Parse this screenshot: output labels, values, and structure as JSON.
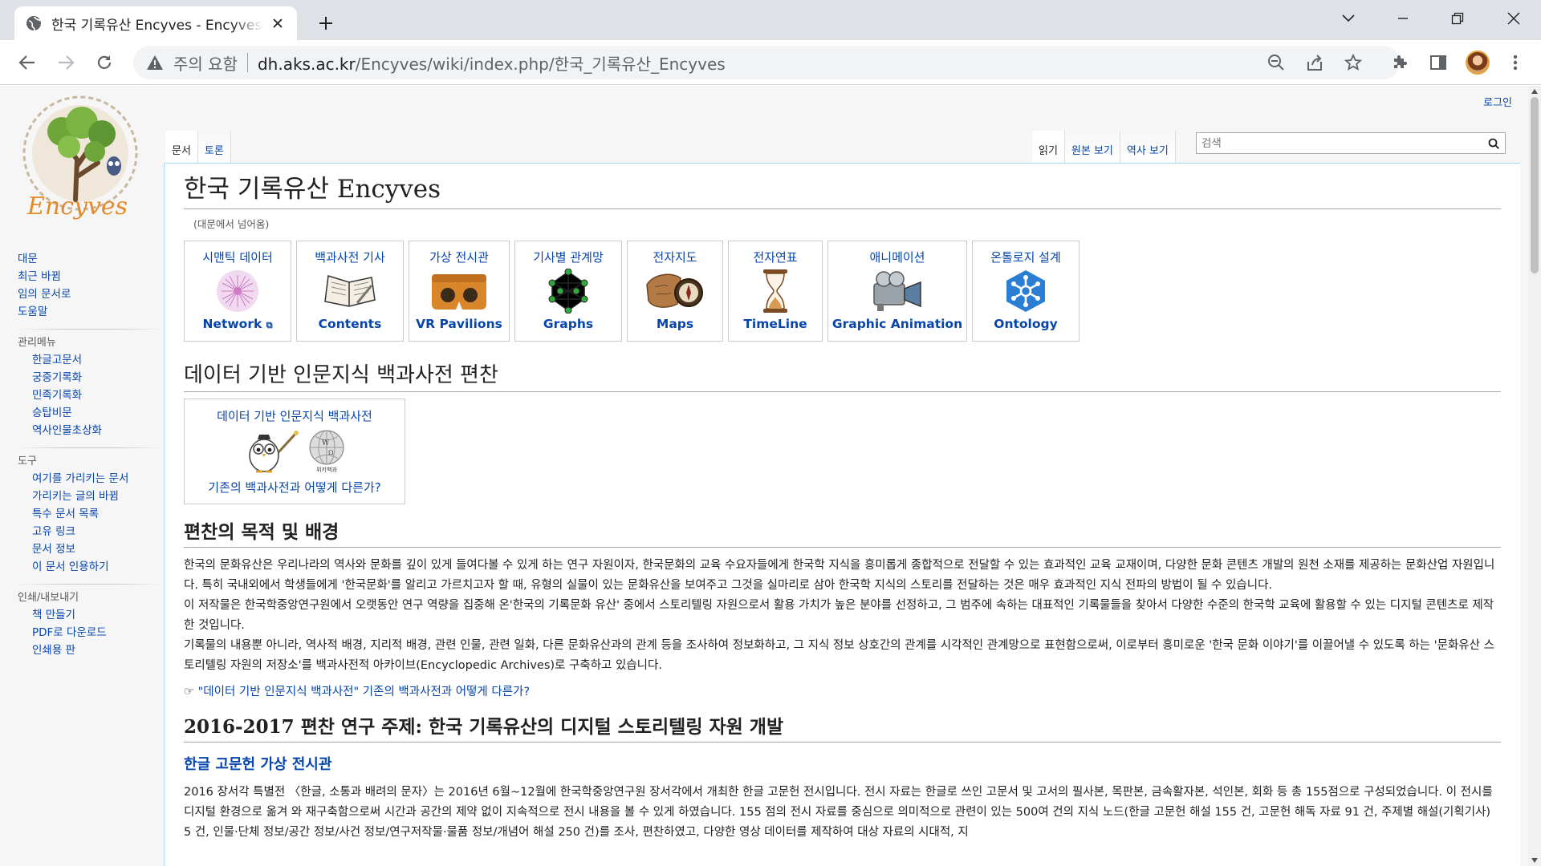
{
  "browser": {
    "tab_title": "한국 기록유산 Encyves - Encyves",
    "address_security": "주의 요함",
    "address_host": "dh.aks.ac.kr",
    "address_path": "/Encyves/wiki/index.php/한국_기록유산_Encyves"
  },
  "header": {
    "login": "로그인",
    "tabs_left": [
      "문서",
      "토론"
    ],
    "tabs_right": [
      "읽기",
      "원본 보기",
      "역사 보기"
    ],
    "search_placeholder": "검색"
  },
  "sidebar": {
    "main": [
      "대문",
      "최근 바뀜",
      "임의 문서로",
      "도움말"
    ],
    "sections": [
      {
        "title": "관리메뉴",
        "items": [
          "한글고문서",
          "궁중기록화",
          "민족기록화",
          "승탑비문",
          "역사인물초상화"
        ]
      },
      {
        "title": "도구",
        "items": [
          "여기를 가리키는 문서",
          "가리키는 글의 바뀜",
          "특수 문서 목록",
          "고유 링크",
          "문서 정보",
          "이 문서 인용하기"
        ]
      },
      {
        "title": "인쇄/내보내기",
        "items": [
          "책 만들기",
          "PDF로 다운로드",
          "인쇄용 판"
        ]
      }
    ]
  },
  "article": {
    "title": "한국 기록유산 Encyves",
    "redirect": "(대문에서 넘어옴)",
    "icons": [
      {
        "top": "시맨틱 데이터",
        "bottom": "Network",
        "icon": "network-icon",
        "width": 132
      },
      {
        "top": "백과사전 기사",
        "bottom": "Contents",
        "icon": "book-icon",
        "width": 134
      },
      {
        "top": "가상 전시관",
        "bottom": "VR Pavilions",
        "icon": "vr-headset-icon",
        "width": 126
      },
      {
        "top": "기사별 관계망",
        "bottom": "Graphs",
        "icon": "graph-icon",
        "width": 134
      },
      {
        "top": "전자지도",
        "bottom": "Maps",
        "icon": "map-compass-icon",
        "width": 118
      },
      {
        "top": "전자연표",
        "bottom": "TimeLine",
        "icon": "hourglass-icon",
        "width": 118
      },
      {
        "top": "애니메이션",
        "bottom": "Graphic Animation",
        "icon": "camera-icon",
        "width": 174
      },
      {
        "top": "온톨로지 설계",
        "bottom": "Ontology",
        "icon": "ontology-icon",
        "width": 134
      }
    ],
    "section1": "데이터 기반 인문지식 백과사전 편찬",
    "compare_line1": "데이터 기반 인문지식 백과사전",
    "compare_line2": "기존의 백과사전과 어떻게 다른가?",
    "wiki_caption": "위키백과",
    "section2": "편찬의 목적 및 배경",
    "paragraphs": [
      "한국의 문화유산은 우리나라의 역사와 문화를 깊이 있게 들여다볼 수 있게 하는 연구 자원이자, 한국문화의 교육 수요자들에게 한국학 지식을 흥미롭게 종합적으로 전달할 수 있는 효과적인 교육 교재이며, 다양한 문화 콘텐츠 개발의 원천 소재를 제공하는 문화산업 자원입니다. 특히 국내외에서 학생들에게 '한국문화'를 알리고 가르치고자 할 때, 유형의 실물이 있는 문화유산을 보여주고 그것을 실마리로 삼아 한국학 지식의 스토리를 전달하는 것은 매우 효과적인 지식 전파의 방법이 될 수 있습니다.",
      "이 저작물은 한국학중앙연구원에서 오랫동안 연구 역량을 집중해 온'한국의 기록문화 유산' 중에서 스토리텔링 자원으로서 활용 가치가 높은 분야를 선정하고, 그 범주에 속하는 대표적인 기록물들을 찾아서 다양한 수준의 한국학 교육에 활용할 수 있는 디지털 콘텐츠로 제작한 것입니다.",
      "기록물의 내용뿐 아니라, 역사적 배경, 지리적 배경, 관련 인물, 관련 일화, 다른 문화유산과의 관계 등을 조사하여 정보화하고, 그 지식 정보 상호간의 관계를 시각적인 관계망으로 표현함으로써, 이로부터 흥미로운 '한국 문화 이야기'를 이끌어낼 수 있도록 하는 '문화유산 스토리텔링 자원의 저장소'를 백과사전적 아카이브(Encyclopedic Archives)로 구축하고 있습니다."
    ],
    "link_line": "\"데이터 기반 인문지식 백과사전\" 기존의 백과사전과 어떻게 다른가?",
    "section3": "2016-2017 편찬 연구 주제: 한국 기록유산의 디지털 스토리텔링 자원 개발",
    "subsection1": "한글 고문헌 가상 전시관",
    "para_last": "2016 장서각 특별전 〈한글, 소통과 배려의 문자〉는 2016년 6월~12월에 한국학중앙연구원 장서각에서 개최한 한글 고문헌 전시입니다. 전시 자료는 한글로 쓰인 고문서 및 고서의 필사본, 목판본, 금속활자본, 석인본, 회화 등 총 155점으로 구성되었습니다. 이 전시를 디지털 환경으로 옮겨 와 재구축함으로써 시간과 공간의 제약 없이 지속적으로 전시 내용을 볼 수 있게 하였습니다. 155 점의 전시 자료를 중심으로 의미적으로 관련이 있는 500여 건의 지식 노드(한글 고문헌 해설 155 건, 고문헌 해독 자료 91 건, 주제별 해설(기획기사) 5 건, 인물·단체 정보/공간 정보/사건 정보/연구저작물·물품 정보/개념어 해설 250 건)를 조사, 편찬하였고, 다양한 영상 데이터를 제작하여 대상 자료의 시대적, 지"
  }
}
